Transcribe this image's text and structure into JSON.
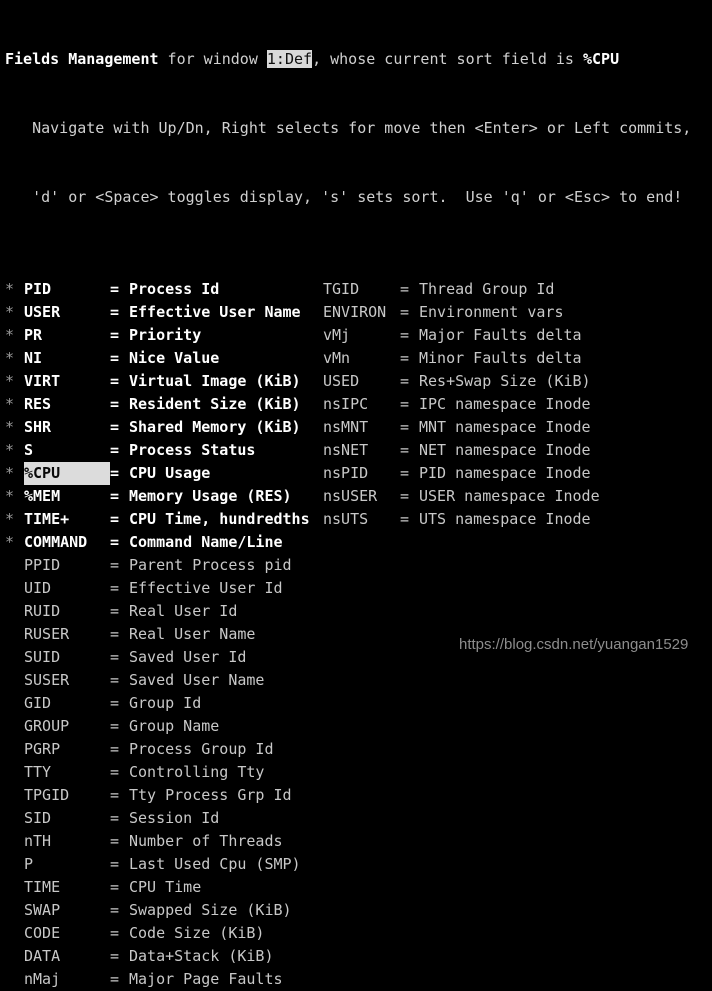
{
  "terminal": {
    "title": "Fields Management",
    "header": {
      "part1": "Fields Management",
      "part2": " for window ",
      "window": "1:Def",
      "part3": ", whose current sort field is ",
      "sort_field": "%CPU"
    },
    "help_line_1": "   Navigate with Up/Dn, Right selects for move then <Enter> or Left commits,",
    "help_line_2": "   'd' or <Space> toggles display, 's' sets sort.  Use 'q' or <Esc> to end!",
    "selected_field": "%CPU",
    "left_column": [
      {
        "mark": "*",
        "name": "PID",
        "eq": "=",
        "desc": "Process Id",
        "enabled": true,
        "selected": false
      },
      {
        "mark": "*",
        "name": "USER",
        "eq": "=",
        "desc": "Effective User Name",
        "enabled": true,
        "selected": false
      },
      {
        "mark": "*",
        "name": "PR",
        "eq": "=",
        "desc": "Priority",
        "enabled": true,
        "selected": false
      },
      {
        "mark": "*",
        "name": "NI",
        "eq": "=",
        "desc": "Nice Value",
        "enabled": true,
        "selected": false
      },
      {
        "mark": "*",
        "name": "VIRT",
        "eq": "=",
        "desc": "Virtual Image (KiB)",
        "enabled": true,
        "selected": false
      },
      {
        "mark": "*",
        "name": "RES",
        "eq": "=",
        "desc": "Resident Size (KiB)",
        "enabled": true,
        "selected": false
      },
      {
        "mark": "*",
        "name": "SHR",
        "eq": "=",
        "desc": "Shared Memory (KiB)",
        "enabled": true,
        "selected": false
      },
      {
        "mark": "*",
        "name": "S",
        "eq": "=",
        "desc": "Process Status",
        "enabled": true,
        "selected": false
      },
      {
        "mark": "*",
        "name": "%CPU",
        "eq": "=",
        "desc": "CPU Usage",
        "enabled": true,
        "selected": true
      },
      {
        "mark": "*",
        "name": "%MEM",
        "eq": "=",
        "desc": "Memory Usage (RES)",
        "enabled": true,
        "selected": false
      },
      {
        "mark": "*",
        "name": "TIME+",
        "eq": "=",
        "desc": "CPU Time, hundredths",
        "enabled": true,
        "selected": false
      },
      {
        "mark": "*",
        "name": "COMMAND",
        "eq": "=",
        "desc": "Command Name/Line",
        "enabled": true,
        "selected": false
      },
      {
        "mark": " ",
        "name": "PPID",
        "eq": "=",
        "desc": "Parent Process pid",
        "enabled": false,
        "selected": false
      },
      {
        "mark": " ",
        "name": "UID",
        "eq": "=",
        "desc": "Effective User Id",
        "enabled": false,
        "selected": false
      },
      {
        "mark": " ",
        "name": "RUID",
        "eq": "=",
        "desc": "Real User Id",
        "enabled": false,
        "selected": false
      },
      {
        "mark": " ",
        "name": "RUSER",
        "eq": "=",
        "desc": "Real User Name",
        "enabled": false,
        "selected": false
      },
      {
        "mark": " ",
        "name": "SUID",
        "eq": "=",
        "desc": "Saved User Id",
        "enabled": false,
        "selected": false
      },
      {
        "mark": " ",
        "name": "SUSER",
        "eq": "=",
        "desc": "Saved User Name",
        "enabled": false,
        "selected": false
      },
      {
        "mark": " ",
        "name": "GID",
        "eq": "=",
        "desc": "Group Id",
        "enabled": false,
        "selected": false
      },
      {
        "mark": " ",
        "name": "GROUP",
        "eq": "=",
        "desc": "Group Name",
        "enabled": false,
        "selected": false
      },
      {
        "mark": " ",
        "name": "PGRP",
        "eq": "=",
        "desc": "Process Group Id",
        "enabled": false,
        "selected": false
      },
      {
        "mark": " ",
        "name": "TTY",
        "eq": "=",
        "desc": "Controlling Tty",
        "enabled": false,
        "selected": false
      },
      {
        "mark": " ",
        "name": "TPGID",
        "eq": "=",
        "desc": "Tty Process Grp Id",
        "enabled": false,
        "selected": false
      },
      {
        "mark": " ",
        "name": "SID",
        "eq": "=",
        "desc": "Session Id",
        "enabled": false,
        "selected": false
      },
      {
        "mark": " ",
        "name": "nTH",
        "eq": "=",
        "desc": "Number of Threads",
        "enabled": false,
        "selected": false
      },
      {
        "mark": " ",
        "name": "P",
        "eq": "=",
        "desc": "Last Used Cpu (SMP)",
        "enabled": false,
        "selected": false
      },
      {
        "mark": " ",
        "name": "TIME",
        "eq": "=",
        "desc": "CPU Time",
        "enabled": false,
        "selected": false
      },
      {
        "mark": " ",
        "name": "SWAP",
        "eq": "=",
        "desc": "Swapped Size (KiB)",
        "enabled": false,
        "selected": false
      },
      {
        "mark": " ",
        "name": "CODE",
        "eq": "=",
        "desc": "Code Size (KiB)",
        "enabled": false,
        "selected": false
      },
      {
        "mark": " ",
        "name": "DATA",
        "eq": "=",
        "desc": "Data+Stack (KiB)",
        "enabled": false,
        "selected": false
      },
      {
        "mark": " ",
        "name": "nMaj",
        "eq": "=",
        "desc": "Major Page Faults",
        "enabled": false,
        "selected": false
      }
    ],
    "right_column": [
      {
        "name": "TGID",
        "eq": "=",
        "desc": "Thread Group Id"
      },
      {
        "name": "ENVIRON",
        "eq": "=",
        "desc": "Environment vars"
      },
      {
        "name": "vMj",
        "eq": "=",
        "desc": "Major Faults delta"
      },
      {
        "name": "vMn",
        "eq": "=",
        "desc": "Minor Faults delta"
      },
      {
        "name": "USED",
        "eq": "=",
        "desc": "Res+Swap Size (KiB)"
      },
      {
        "name": "nsIPC",
        "eq": "=",
        "desc": "IPC namespace Inode"
      },
      {
        "name": "nsMNT",
        "eq": "=",
        "desc": "MNT namespace Inode"
      },
      {
        "name": "nsNET",
        "eq": "=",
        "desc": "NET namespace Inode"
      },
      {
        "name": "nsPID",
        "eq": "=",
        "desc": "PID namespace Inode"
      },
      {
        "name": "nsUSER",
        "eq": "=",
        "desc": "USER namespace Inode"
      },
      {
        "name": "nsUTS",
        "eq": "=",
        "desc": "UTS namespace Inode"
      }
    ],
    "watermark": "https://blog.csdn.net/yuangan1529",
    "colors": {
      "background": "#000000",
      "foreground": "#d0d0d0",
      "bold": "#ffffff",
      "inverse_bg": "#dcdcdc",
      "inverse_fg": "#0a0a0a",
      "watermark": "#8d8d8d"
    }
  }
}
